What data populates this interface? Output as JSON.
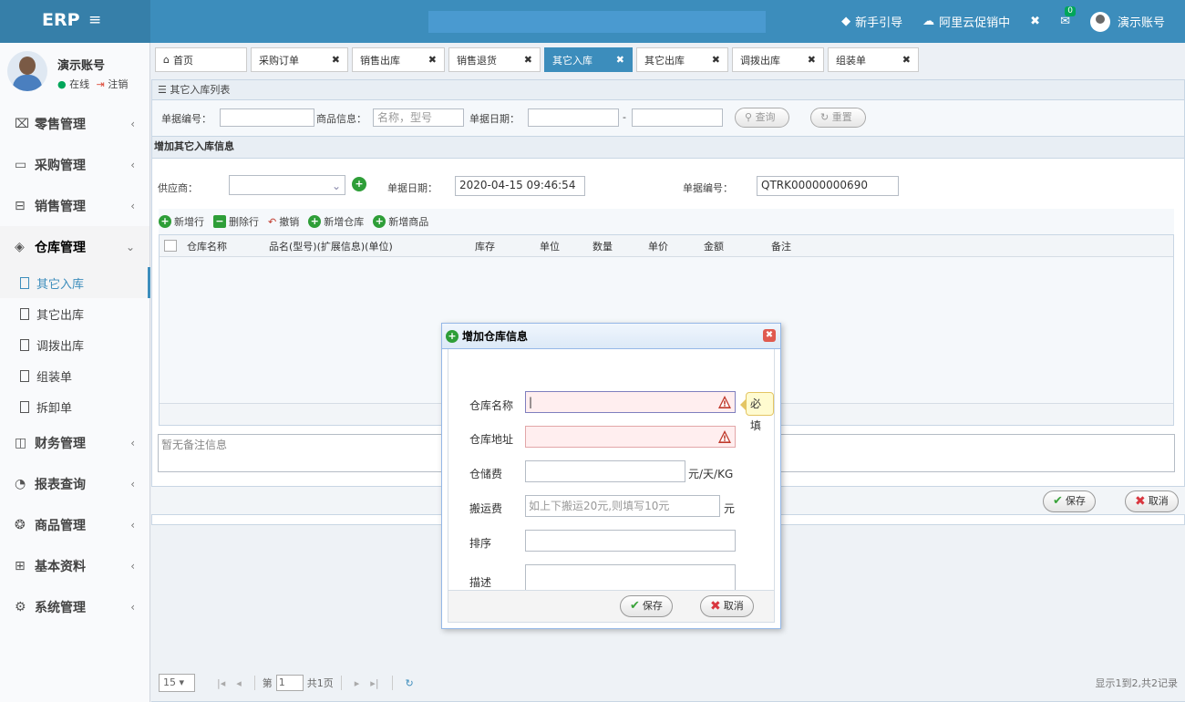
{
  "app": {
    "logo": "ERP",
    "menu_icon": "≡"
  },
  "topnav": {
    "guide": "新手引导",
    "promo": "阿里云促销中",
    "msg_count": "0",
    "account": "演示账号"
  },
  "user": {
    "name": "演示账号",
    "status": "在线",
    "logout": "注销"
  },
  "sidebar": {
    "items": [
      {
        "label": "零售管理",
        "icon": "gift-icon"
      },
      {
        "label": "采购管理",
        "icon": "cart-icon"
      },
      {
        "label": "销售管理",
        "icon": "store-icon"
      },
      {
        "label": "仓库管理",
        "icon": "warehouse-icon"
      },
      {
        "label": "财务管理",
        "icon": "finance-icon"
      },
      {
        "label": "报表查询",
        "icon": "report-icon"
      },
      {
        "label": "商品管理",
        "icon": "goods-icon"
      },
      {
        "label": "基本资料",
        "icon": "grid-icon"
      },
      {
        "label": "系统管理",
        "icon": "settings-icon"
      }
    ],
    "sub_items": [
      "其它入库",
      "其它出库",
      "调拨出库",
      "组装单",
      "拆卸单"
    ]
  },
  "tabs": [
    {
      "label": "首页"
    },
    {
      "label": "采购订单"
    },
    {
      "label": "销售出库"
    },
    {
      "label": "销售退货"
    },
    {
      "label": "其它入库"
    },
    {
      "label": "其它出库"
    },
    {
      "label": "调拨出库"
    },
    {
      "label": "组装单"
    }
  ],
  "list_panel": {
    "title": "其它入库列表",
    "bill_no_label": "单据编号：",
    "goods_label": "商品信息：",
    "goods_placeholder": "名称，型号",
    "date_label": "单据日期：",
    "query_btn": "查询",
    "reset_btn": "重置"
  },
  "form": {
    "title": "增加其它入库信息",
    "supplier_label": "供应商：",
    "bill_date_label": "单据日期：",
    "bill_date": "2020-04-15 09:46:54",
    "bill_no_label": "单据编号：",
    "bill_no": "QTRK00000000690",
    "toolbar": [
      "新增行",
      "删除行",
      "撤销",
      "新增仓库",
      "新增商品"
    ],
    "columns": [
      "仓库名称",
      "品名(型号)(扩展信息)(单位)",
      "库存",
      "单位",
      "数量",
      "单价",
      "金额",
      "备注"
    ],
    "remark_placeholder": "暂无备注信息",
    "save_btn": "保存",
    "cancel_btn": "取消"
  },
  "pager": {
    "page_size": "15",
    "page_label": "第",
    "page": "1",
    "total_pages": "共1页",
    "info": "显示1到2,共2记录"
  },
  "dialog": {
    "title": "增加仓库信息",
    "name_label": "仓库名称",
    "address_label": "仓库地址",
    "storage_fee_label": "仓储费",
    "storage_fee_unit": "元/天/KG",
    "carry_fee_label": "搬运费",
    "carry_fee_placeholder": "如上下搬运20元,则填写10元",
    "carry_fee_unit": "元",
    "sort_label": "排序",
    "desc_label": "描述",
    "required_tip": "必填",
    "save_btn": "保存",
    "cancel_btn": "取消"
  },
  "colors": {
    "primary": "#3c8dbc",
    "dark_primary": "#367fa9",
    "success": "#00a65a",
    "danger": "#dd4b39"
  }
}
